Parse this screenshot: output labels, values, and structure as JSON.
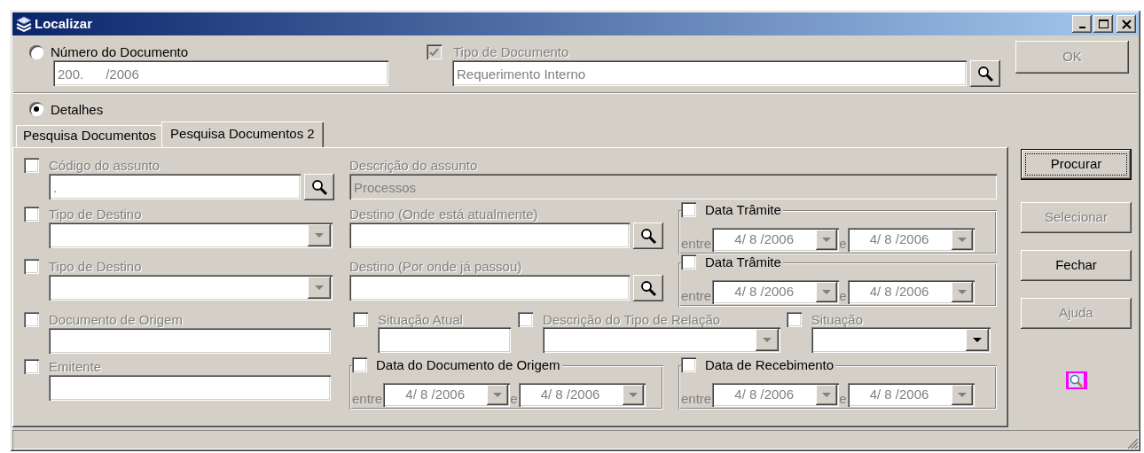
{
  "window": {
    "title": "Localizar"
  },
  "document_number": {
    "label": "Número do Documento",
    "selected": false,
    "value": "200.      /2006"
  },
  "document_type": {
    "label": "Tipo de Documento",
    "checked": true,
    "disabled": true,
    "value": "Requerimento Interno"
  },
  "ok_button": {
    "label": "OK",
    "disabled": true
  },
  "details": {
    "label": "Detalhes",
    "selected": true
  },
  "tabs": [
    {
      "label": "Pesquisa Documentos",
      "selected": false
    },
    {
      "label": "Pesquisa Documentos 2",
      "selected": true
    }
  ],
  "subject_code": {
    "label": "Código do assunto",
    "checked": false,
    "value": "."
  },
  "subject_description": {
    "label": "Descrição do assunto",
    "value": "Processos"
  },
  "destination_type_1": {
    "label": "Tipo de Destino",
    "checked": false,
    "disabled": true
  },
  "current_destination": {
    "label": "Destino (Onde está atualmente)"
  },
  "transit_date_1": {
    "label": "Data Trâmite",
    "checked": false,
    "range_label": "entre",
    "separator": "e",
    "from": "4/ 8 /2006",
    "to": "4/ 8 /2006"
  },
  "destination_type_2": {
    "label": "Tipo de Destino",
    "checked": false,
    "disabled": true
  },
  "past_destination": {
    "label": "Destino (Por onde já passou)"
  },
  "transit_date_2": {
    "label": "Data Trâmite",
    "checked": false,
    "range_label": "entre",
    "separator": "e",
    "from": "4/ 8 /2006",
    "to": "4/ 8 /2006"
  },
  "origin_document": {
    "label": "Documento de Origem",
    "checked": false
  },
  "current_status": {
    "label": "Situação Atual",
    "checked": false
  },
  "relation_type_description": {
    "label": "Descrição do Tipo de Relação",
    "checked": false,
    "disabled": true
  },
  "status": {
    "label": "Situação",
    "checked": false,
    "disabled": false
  },
  "issuer": {
    "label": "Emitente",
    "checked": false
  },
  "origin_document_date": {
    "label": "Data do Documento de Origem",
    "checked": false,
    "range_label": "entre",
    "separator": "e",
    "from": "4/ 8 /2006",
    "to": "4/ 8 /2006"
  },
  "receipt_date": {
    "label": "Data de Recebimento",
    "checked": false,
    "range_label": "entre",
    "separator": "e",
    "from": "4/ 8 /2006",
    "to": "4/ 8 /2006"
  },
  "buttons": [
    {
      "label": "Procurar",
      "disabled": false,
      "default": true
    },
    {
      "label": "Selecionar",
      "disabled": true,
      "default": false
    },
    {
      "label": "Fechar",
      "disabled": false,
      "default": false
    },
    {
      "label": "Ajuda",
      "disabled": true,
      "default": false
    }
  ]
}
